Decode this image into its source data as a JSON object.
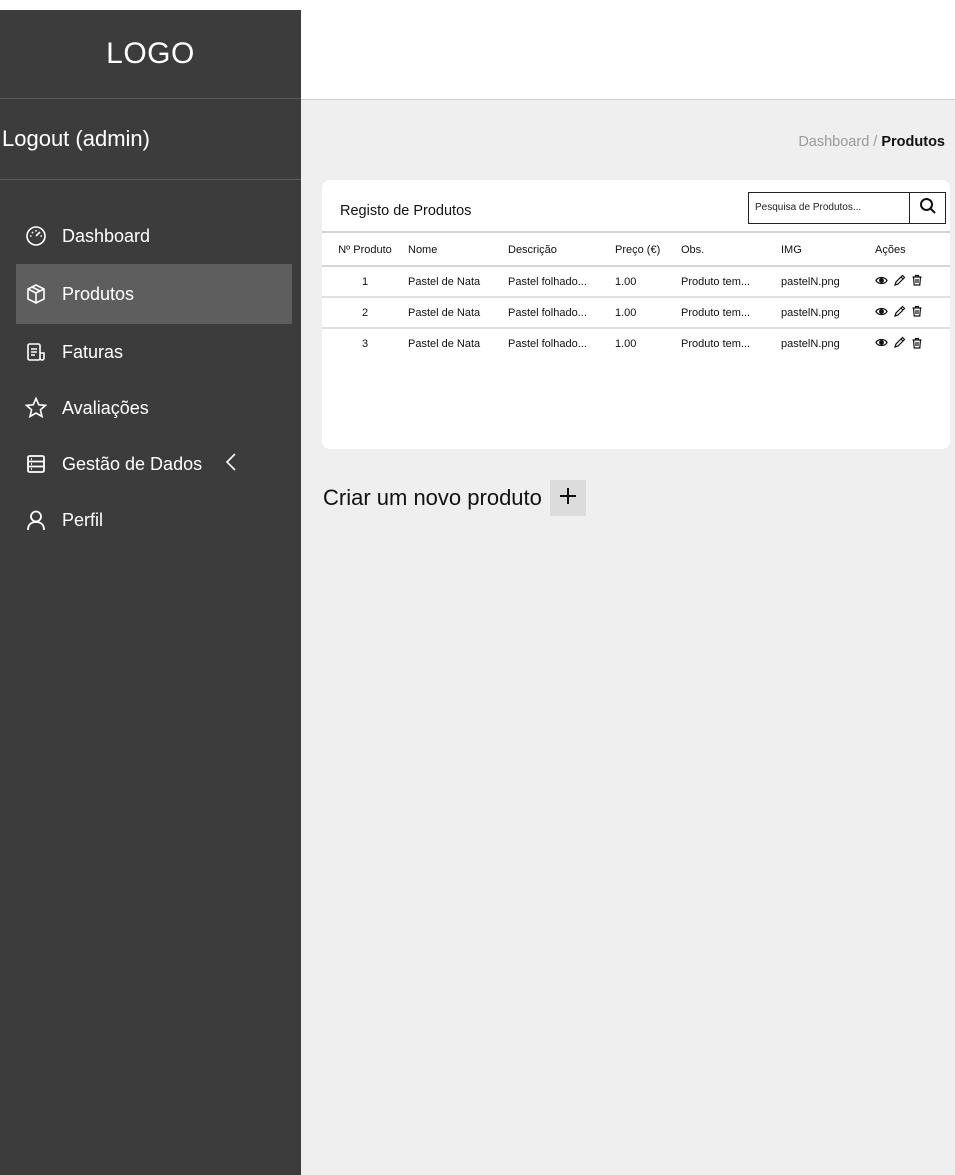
{
  "sidebar": {
    "logo": "LOGO",
    "logout": "Logout (admin)",
    "items": [
      {
        "label": "Dashboard",
        "icon": "gauge-icon"
      },
      {
        "label": "Produtos",
        "icon": "box-icon",
        "active": true
      },
      {
        "label": "Faturas",
        "icon": "invoice-icon"
      },
      {
        "label": "Avaliações",
        "icon": "star-icon"
      },
      {
        "label": "Gestão de Dados",
        "icon": "database-icon"
      },
      {
        "label": "Perfil",
        "icon": "user-icon"
      }
    ]
  },
  "breadcrumb": {
    "root": "Dashboard",
    "separator": " / ",
    "current": "Produtos"
  },
  "card": {
    "title": "Registo de Produtos",
    "search_placeholder": "Pesquisa de Produtos...",
    "columns": [
      "Nº Produto",
      "Nome",
      "Descrição",
      "Preço (€)",
      "Obs.",
      "IMG",
      "Ações"
    ],
    "rows": [
      {
        "id": "1",
        "nome": "Pastel de Nata",
        "descricao": "Pastel folhado...",
        "preco": "1.00",
        "obs": "Produto tem...",
        "img": "pastelN.png"
      },
      {
        "id": "2",
        "nome": "Pastel de Nata",
        "descricao": "Pastel folhado...",
        "preco": "1.00",
        "obs": "Produto tem...",
        "img": "pastelN.png"
      },
      {
        "id": "3",
        "nome": "Pastel de Nata",
        "descricao": "Pastel folhado...",
        "preco": "1.00",
        "obs": "Produto tem...",
        "img": "pastelN.png"
      }
    ]
  },
  "create": {
    "label": "Criar um novo produto"
  },
  "colors": {
    "sidebar": "#3c3c3c",
    "active_item": "#5e5e5e",
    "content_bg": "#efefef"
  }
}
